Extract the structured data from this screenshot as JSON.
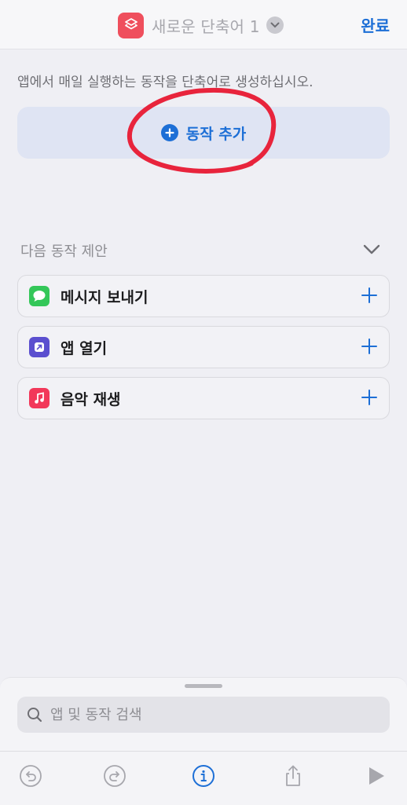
{
  "navbar": {
    "title": "새로운 단축어 1",
    "done_label": "완료"
  },
  "editor": {
    "hint": "앱에서 매일 실행하는 동작을 단축어로 생성하십시오.",
    "add_action_label": "동작 추가"
  },
  "suggestions": {
    "header": "다음 동작 제안",
    "items": [
      {
        "label": "메시지 보내기",
        "icon": "messages-icon",
        "color": "#34c759"
      },
      {
        "label": "앱 열기",
        "icon": "open-app-icon",
        "color": "#5b4fcf"
      },
      {
        "label": "음악 재생",
        "icon": "music-icon",
        "color": "#f2385a"
      }
    ]
  },
  "search": {
    "placeholder": "앱 및 동작 검색",
    "value": ""
  },
  "toolbar": {
    "buttons": [
      "undo-icon",
      "redo-icon",
      "info-icon",
      "share-icon",
      "play-icon"
    ]
  },
  "colors": {
    "accent": "#1d6fd6",
    "annotation": "#e8243c",
    "app_icon": "#ef4f5d"
  }
}
